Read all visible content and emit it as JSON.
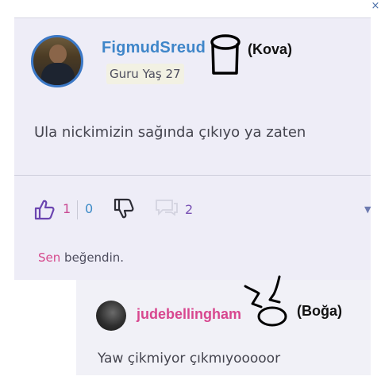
{
  "window": {
    "close_glyph": "×"
  },
  "post": {
    "username": "FigmudSreud",
    "rank": "Guru",
    "age_label": "Yaş 27",
    "message": "Ula nickimizin sağında çıkıyo ya zaten",
    "likes": "1",
    "dislikes": "0",
    "comments": "2",
    "liked_by": "Sen",
    "liked_suffix": "beğendin.",
    "avatar_icon": "user-photo",
    "like_icon": "thumbs-up-icon",
    "dislike_icon": "thumbs-down-icon",
    "comment_icon": "speech-bubble-icon",
    "more_icon": "chevron-down-icon"
  },
  "reply": {
    "username": "judebellingham",
    "message": "Yaw çikmiyor çıkmıyooooor"
  },
  "annotations": {
    "aquarius_label": "(Kova)",
    "taurus_label": "(Boğa)"
  },
  "colors": {
    "card_bg": "#eeedf7",
    "username_blue": "#3f86c9",
    "pink": "#d8478f",
    "purple": "#7a52b4"
  }
}
